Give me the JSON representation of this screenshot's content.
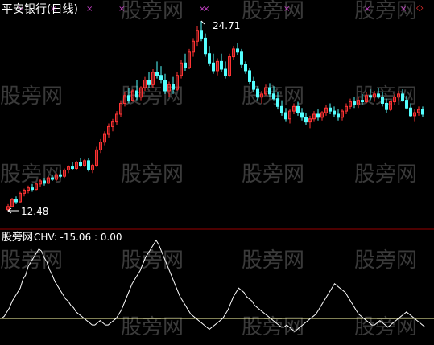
{
  "main_panel": {
    "title": "平安银行(日线)",
    "high_label": "24.71",
    "low_label": "12.48",
    "sell_marker_glyph": "×",
    "signal_marker_glyph": "◇",
    "rise_color": "#ff3333",
    "fall_color": "#54ffff",
    "marker_color": "#cc44cc"
  },
  "sub_panel": {
    "title": "股旁网",
    "indicator": "CHV: -15.06 : 0.00",
    "line_color": "#ffffff",
    "zero_line_color": "#ffffaa"
  },
  "watermark": "股旁网",
  "divider_color": "#990000",
  "chart_data": [
    {
      "type": "candlestick",
      "title": "平安银行(日线)",
      "annotations": [
        {
          "label": "24.71",
          "type": "high"
        },
        {
          "label": "12.48",
          "type": "low"
        }
      ],
      "price_range": [
        12.48,
        24.71
      ],
      "candles": [
        [
          12.55,
          12.9,
          12.48,
          12.75
        ],
        [
          12.75,
          13.3,
          12.7,
          13.2
        ],
        [
          13.2,
          13.4,
          12.9,
          13.05
        ],
        [
          13.05,
          13.7,
          13.0,
          13.6
        ],
        [
          13.6,
          13.9,
          13.4,
          13.8
        ],
        [
          13.8,
          14.1,
          13.6,
          13.95
        ],
        [
          13.95,
          14.2,
          13.7,
          13.85
        ],
        [
          13.85,
          14.3,
          13.8,
          14.2
        ],
        [
          14.2,
          14.5,
          14.0,
          14.4
        ],
        [
          14.4,
          14.6,
          14.1,
          14.25
        ],
        [
          14.25,
          14.7,
          14.2,
          14.6
        ],
        [
          14.6,
          14.8,
          14.4,
          14.5
        ],
        [
          14.5,
          14.9,
          14.4,
          14.8
        ],
        [
          14.8,
          15.1,
          14.6,
          14.7
        ],
        [
          14.7,
          15.2,
          14.6,
          15.1
        ],
        [
          15.1,
          15.4,
          14.9,
          15.3
        ],
        [
          15.3,
          15.6,
          15.1,
          15.2
        ],
        [
          15.2,
          15.7,
          15.1,
          15.6
        ],
        [
          15.6,
          15.9,
          15.3,
          15.4
        ],
        [
          15.4,
          15.8,
          15.3,
          15.7
        ],
        [
          15.7,
          15.9,
          15.0,
          15.1
        ],
        [
          15.1,
          15.5,
          14.9,
          15.4
        ],
        [
          15.4,
          16.6,
          15.3,
          16.4
        ],
        [
          16.4,
          17.1,
          16.2,
          16.9
        ],
        [
          16.9,
          17.6,
          16.7,
          17.4
        ],
        [
          17.4,
          18.1,
          17.2,
          17.9
        ],
        [
          17.9,
          18.4,
          17.6,
          18.2
        ],
        [
          18.2,
          18.9,
          18.0,
          18.7
        ],
        [
          18.7,
          19.6,
          18.5,
          19.4
        ],
        [
          19.4,
          20.1,
          19.2,
          19.9
        ],
        [
          19.9,
          20.4,
          19.4,
          19.6
        ],
        [
          19.6,
          20.3,
          19.5,
          20.2
        ],
        [
          20.2,
          20.9,
          19.6,
          19.8
        ],
        [
          19.8,
          20.5,
          19.6,
          20.4
        ],
        [
          20.4,
          21.1,
          20.2,
          20.9
        ],
        [
          20.9,
          21.4,
          20.4,
          20.6
        ],
        [
          20.6,
          21.6,
          20.4,
          21.4
        ],
        [
          21.4,
          22.1,
          21.0,
          21.2
        ],
        [
          21.2,
          21.8,
          20.7,
          20.9
        ],
        [
          20.9,
          21.3,
          20.0,
          20.2
        ],
        [
          20.2,
          20.8,
          19.8,
          20.6
        ],
        [
          20.6,
          21.1,
          20.0,
          20.3
        ],
        [
          20.3,
          21.4,
          20.2,
          21.2
        ],
        [
          21.2,
          22.2,
          21.0,
          22.0
        ],
        [
          22.0,
          22.6,
          21.5,
          21.7
        ],
        [
          21.7,
          22.9,
          21.6,
          22.7
        ],
        [
          22.7,
          23.6,
          22.4,
          23.4
        ],
        [
          23.4,
          24.4,
          23.1,
          24.1
        ],
        [
          24.1,
          24.71,
          23.4,
          23.6
        ],
        [
          23.6,
          23.9,
          22.4,
          22.6
        ],
        [
          22.6,
          23.1,
          21.8,
          22.0
        ],
        [
          22.0,
          22.6,
          21.3,
          21.5
        ],
        [
          21.5,
          22.3,
          21.2,
          22.1
        ],
        [
          22.1,
          22.6,
          21.4,
          21.6
        ],
        [
          21.6,
          22.1,
          21.0,
          21.2
        ],
        [
          21.2,
          22.6,
          21.1,
          22.4
        ],
        [
          22.4,
          23.1,
          22.2,
          22.9
        ],
        [
          22.9,
          23.3,
          22.5,
          22.7
        ],
        [
          22.7,
          22.9,
          21.7,
          21.9
        ],
        [
          21.9,
          22.1,
          21.3,
          21.5
        ],
        [
          21.5,
          21.7,
          20.6,
          20.8
        ],
        [
          20.8,
          21.1,
          20.1,
          20.3
        ],
        [
          20.3,
          20.5,
          19.6,
          19.8
        ],
        [
          19.8,
          20.2,
          19.4,
          20.0
        ],
        [
          20.0,
          20.6,
          19.9,
          20.4
        ],
        [
          20.4,
          20.7,
          19.8,
          20.0
        ],
        [
          20.0,
          20.5,
          19.6,
          19.7
        ],
        [
          19.7,
          20.1,
          19.0,
          19.2
        ],
        [
          19.2,
          19.6,
          18.6,
          18.8
        ],
        [
          18.8,
          19.1,
          18.2,
          18.4
        ],
        [
          18.4,
          19.0,
          18.1,
          18.9
        ],
        [
          18.9,
          19.4,
          18.7,
          19.2
        ],
        [
          19.2,
          19.5,
          18.6,
          18.8
        ],
        [
          18.8,
          19.1,
          18.3,
          18.5
        ],
        [
          18.5,
          18.8,
          18.0,
          18.2
        ],
        [
          18.2,
          18.6,
          17.8,
          18.4
        ],
        [
          18.4,
          18.9,
          18.2,
          18.7
        ],
        [
          18.7,
          19.0,
          18.3,
          18.5
        ],
        [
          18.5,
          18.9,
          18.3,
          18.8
        ],
        [
          18.8,
          19.3,
          18.6,
          19.1
        ],
        [
          19.1,
          19.4,
          18.7,
          18.9
        ],
        [
          18.9,
          19.2,
          18.5,
          18.7
        ],
        [
          18.7,
          19.0,
          18.3,
          18.5
        ],
        [
          18.5,
          19.0,
          18.3,
          18.9
        ],
        [
          18.9,
          19.4,
          18.7,
          19.2
        ],
        [
          19.2,
          19.7,
          19.0,
          19.5
        ],
        [
          19.5,
          19.8,
          19.1,
          19.3
        ],
        [
          19.3,
          19.8,
          19.1,
          19.6
        ],
        [
          19.6,
          20.0,
          19.3,
          19.5
        ],
        [
          19.5,
          20.1,
          19.4,
          19.9
        ],
        [
          19.9,
          20.3,
          19.6,
          19.8
        ],
        [
          19.8,
          20.2,
          19.5,
          20.0
        ],
        [
          20.0,
          20.4,
          19.7,
          19.8
        ],
        [
          19.8,
          20.1,
          19.2,
          19.4
        ],
        [
          19.4,
          19.7,
          18.8,
          19.0
        ],
        [
          19.0,
          19.6,
          18.9,
          19.5
        ],
        [
          19.5,
          20.0,
          19.3,
          19.8
        ],
        [
          19.8,
          20.2,
          19.6,
          20.0
        ],
        [
          20.0,
          20.3,
          19.5,
          19.6
        ],
        [
          19.6,
          19.9,
          19.0,
          19.1
        ],
        [
          19.1,
          19.4,
          18.5,
          18.6
        ],
        [
          18.6,
          19.0,
          18.2,
          18.8
        ],
        [
          18.8,
          19.2,
          18.6,
          19.0
        ],
        [
          19.0,
          19.2,
          18.5,
          18.7
        ]
      ]
    },
    {
      "type": "line",
      "title": "CHV",
      "values_label": "CHV: -15.06 : 0.00",
      "reference_level": 0,
      "series": [
        {
          "values": [
            0,
            2,
            6,
            10,
            16,
            20,
            24,
            28,
            36,
            40,
            48,
            52,
            56,
            60,
            64,
            62,
            56,
            52,
            45,
            40,
            34,
            30,
            26,
            22,
            18,
            16,
            12,
            10,
            6,
            4,
            2,
            0,
            -2,
            -4,
            -6,
            -6,
            -4,
            -2,
            -4,
            -6,
            -6,
            -4,
            -2,
            0,
            4,
            8,
            14,
            20,
            26,
            32,
            36,
            40,
            44,
            50,
            56,
            60,
            64,
            68,
            72,
            68,
            62,
            56,
            50,
            44,
            38,
            32,
            26,
            20,
            16,
            12,
            8,
            4,
            2,
            0,
            -2,
            -4,
            -6,
            -8,
            -10,
            -8,
            -6,
            -4,
            -2,
            0,
            4,
            8,
            14,
            20,
            24,
            28,
            26,
            24,
            20,
            18,
            16,
            12,
            10,
            8,
            6,
            4,
            2,
            0,
            -2,
            -4,
            -6,
            -8,
            -8,
            -6,
            -8,
            -10,
            -12,
            -10,
            -8,
            -6,
            -4,
            -2,
            0,
            2,
            4,
            8,
            12,
            16,
            20,
            24,
            28,
            32,
            30,
            28,
            26,
            24,
            20,
            16,
            12,
            8,
            4,
            2,
            0,
            -2,
            -4,
            -6,
            -6,
            -4,
            -2,
            -4,
            -6,
            -8,
            -6,
            -4,
            -2,
            0,
            2,
            4,
            6,
            4,
            2,
            0,
            -2,
            -4,
            -6,
            -8
          ]
        }
      ]
    }
  ]
}
